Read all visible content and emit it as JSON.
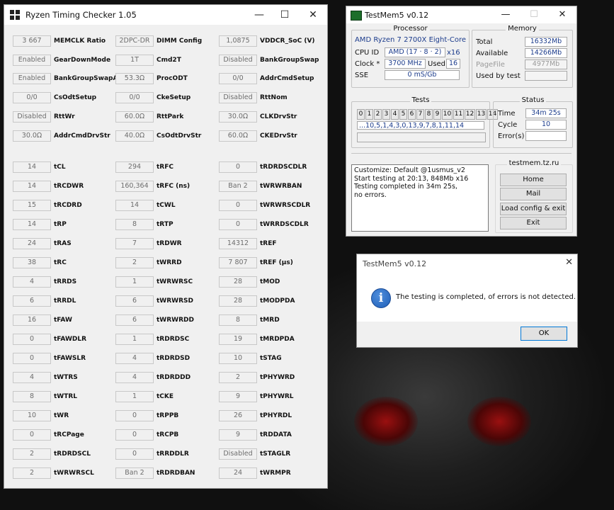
{
  "rtc": {
    "title": "Ryzen Timing Checker 1.05",
    "controls": {
      "minimize": "—",
      "maximize": "☐",
      "close": "✕"
    },
    "section1": [
      [
        {
          "v": "3 667",
          "l": "MEMCLK Ratio"
        },
        {
          "v": "2DPC-DR",
          "l": "DIMM Config"
        },
        {
          "v": "1,0875",
          "l": "VDDCR_SoC (V)"
        }
      ],
      [
        {
          "v": "Enabled",
          "l": "GearDownMode"
        },
        {
          "v": "1T",
          "l": "Cmd2T"
        },
        {
          "v": "Disabled",
          "l": "BankGroupSwap"
        }
      ],
      [
        {
          "v": "Enabled",
          "l": "BankGroupSwapAlt"
        },
        {
          "v": "53.3Ω",
          "l": "ProcODT"
        },
        {
          "v": "0/0",
          "l": "AddrCmdSetup"
        }
      ],
      [
        {
          "v": "0/0",
          "l": "CsOdtSetup"
        },
        {
          "v": "0/0",
          "l": "CkeSetup"
        },
        {
          "v": "Disabled",
          "l": "RttNom"
        }
      ],
      [
        {
          "v": "Disabled",
          "l": "RttWr"
        },
        {
          "v": "60.0Ω",
          "l": "RttPark"
        },
        {
          "v": "30.0Ω",
          "l": "CLKDrvStr"
        }
      ],
      [
        {
          "v": "30.0Ω",
          "l": "AddrCmdDrvStr"
        },
        {
          "v": "40.0Ω",
          "l": "CsOdtDrvStr"
        },
        {
          "v": "60.0Ω",
          "l": "CKEDrvStr"
        }
      ]
    ],
    "section2": [
      [
        {
          "v": "14",
          "l": "tCL"
        },
        {
          "v": "294",
          "l": "tRFC"
        },
        {
          "v": "0",
          "l": "tRDRDSCDLR"
        }
      ],
      [
        {
          "v": "14",
          "l": "tRCDWR"
        },
        {
          "v": "160,364",
          "l": "tRFC (ns)"
        },
        {
          "v": "Ban 2",
          "l": "tWRWRBAN"
        }
      ],
      [
        {
          "v": "15",
          "l": "tRCDRD"
        },
        {
          "v": "14",
          "l": "tCWL"
        },
        {
          "v": "0",
          "l": "tWRWRSCDLR"
        }
      ],
      [
        {
          "v": "14",
          "l": "tRP"
        },
        {
          "v": "8",
          "l": "tRTP"
        },
        {
          "v": "0",
          "l": "tWRRDSCDLR"
        }
      ],
      [
        {
          "v": "24",
          "l": "tRAS"
        },
        {
          "v": "7",
          "l": "tRDWR"
        },
        {
          "v": "14312",
          "l": "tREF"
        }
      ],
      [
        {
          "v": "38",
          "l": "tRC"
        },
        {
          "v": "2",
          "l": "tWRRD"
        },
        {
          "v": "7 807",
          "l": "tREF (µs)"
        }
      ],
      [
        {
          "v": "4",
          "l": "tRRDS"
        },
        {
          "v": "1",
          "l": "tWRWRSC"
        },
        {
          "v": "28",
          "l": "tMOD"
        }
      ],
      [
        {
          "v": "6",
          "l": "tRRDL"
        },
        {
          "v": "6",
          "l": "tWRWRSD"
        },
        {
          "v": "28",
          "l": "tMODPDA"
        }
      ],
      [
        {
          "v": "16",
          "l": "tFAW"
        },
        {
          "v": "6",
          "l": "tWRWRDD"
        },
        {
          "v": "8",
          "l": "tMRD"
        }
      ],
      [
        {
          "v": "0",
          "l": "tFAWDLR"
        },
        {
          "v": "1",
          "l": "tRDRDSC"
        },
        {
          "v": "19",
          "l": "tMRDPDA"
        }
      ],
      [
        {
          "v": "0",
          "l": "tFAWSLR"
        },
        {
          "v": "4",
          "l": "tRDRDSD"
        },
        {
          "v": "10",
          "l": "tSTAG"
        }
      ],
      [
        {
          "v": "4",
          "l": "tWTRS"
        },
        {
          "v": "4",
          "l": "tRDRDDD"
        },
        {
          "v": "2",
          "l": "tPHYWRD"
        }
      ],
      [
        {
          "v": "8",
          "l": "tWTRL"
        },
        {
          "v": "1",
          "l": "tCKE"
        },
        {
          "v": "9",
          "l": "tPHYWRL"
        }
      ],
      [
        {
          "v": "10",
          "l": "tWR"
        },
        {
          "v": "0",
          "l": "tRPPB"
        },
        {
          "v": "26",
          "l": "tPHYRDL"
        }
      ],
      [
        {
          "v": "0",
          "l": "tRCPage"
        },
        {
          "v": "0",
          "l": "tRCPB"
        },
        {
          "v": "9",
          "l": "tRDDATA"
        }
      ],
      [
        {
          "v": "2",
          "l": "tRDRDSCL"
        },
        {
          "v": "0",
          "l": "tRRDDLR"
        },
        {
          "v": "Disabled",
          "l": "tSTAGLR"
        }
      ],
      [
        {
          "v": "2",
          "l": "tWRWRSCL"
        },
        {
          "v": "Ban 2",
          "l": "tRDRDBAN"
        },
        {
          "v": "24",
          "l": "tWRMPR"
        }
      ]
    ]
  },
  "testmem": {
    "title": "TestMem5 v0.12",
    "controls": {
      "minimize": "—",
      "maximize": "☐",
      "close": "✕"
    },
    "processor": {
      "group_title": "Processor",
      "name": "AMD Ryzen 7 2700X Eight-Core",
      "cpuid_label": "CPU ID",
      "cpuid_value": "AMD  (17 · 8 · 2)",
      "threads": "x16",
      "clock_label": "Clock *",
      "clock_value": "3700 MHz",
      "used_label": "Used",
      "used_value": "16",
      "sse_label": "SSE",
      "sse_value": "0 mS/Gb"
    },
    "memory": {
      "group_title": "Memory",
      "total_label": "Total",
      "total_value": "16332Mb",
      "available_label": "Available",
      "available_value": "14266Mb",
      "pagefile_label": "PageFile",
      "pagefile_value": "4977Mb",
      "usedbytest_label": "Used by test",
      "usedbytest_value": ""
    },
    "tests": {
      "group_title": "Tests",
      "cells": [
        "0",
        "1",
        "2",
        "3",
        "4",
        "5",
        "6",
        "7",
        "8",
        "9",
        "10",
        "11",
        "12",
        "13",
        "14"
      ],
      "sequence": "...10,5,1,4,3,0,13,9,7,8,1,11,14"
    },
    "status": {
      "group_title": "Status",
      "time_label": "Time",
      "time_value": "34m 25s",
      "cycle_label": "Cycle",
      "cycle_value": "10",
      "errors_label": "Error(s)",
      "errors_value": ""
    },
    "log": [
      "Customize: Default @1usmus_v2",
      "Start testing at 20:13, 848Mb x16",
      "Testing completed in 34m 25s,",
      "no errors."
    ],
    "links": {
      "group_title": "testmem.tz.ru",
      "home": "Home",
      "mail": "Mail",
      "load": "Load config & exit",
      "exit": "Exit"
    }
  },
  "dialog": {
    "title": "TestMem5 v0.12",
    "close": "✕",
    "message": "The testing is completed, of errors is not detected.",
    "ok": "OK"
  }
}
